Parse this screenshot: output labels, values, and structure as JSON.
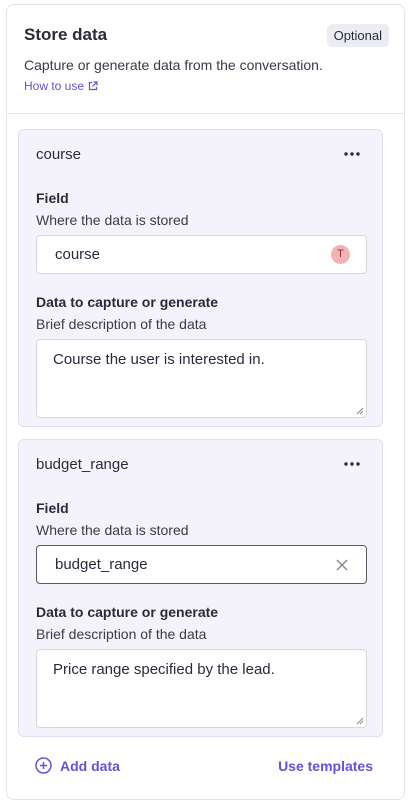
{
  "header": {
    "title": "Store data",
    "badge": "Optional",
    "subtitle": "Capture or generate data from the conversation.",
    "how_to_link": "How to use"
  },
  "cards": [
    {
      "name": "course",
      "field_label": "Field",
      "field_hint": "Where the data is stored",
      "field_value": "course",
      "field_avatar": "T",
      "desc_label": "Data to capture or generate",
      "desc_hint": "Brief description of the data",
      "desc_value": "Course the user is interested in."
    },
    {
      "name": "budget_range",
      "field_label": "Field",
      "field_hint": "Where the data is stored",
      "field_value": "budget_range",
      "desc_label": "Data to capture or generate",
      "desc_hint": "Brief description of the data",
      "desc_value": "Price range specified by the lead."
    }
  ],
  "footer": {
    "add_label": "Add data",
    "templates_label": "Use templates"
  },
  "colors": {
    "accent": "#6b4fd8",
    "card_bg": "#f4f3fc",
    "avatar_bg": "#f3b3b5"
  }
}
